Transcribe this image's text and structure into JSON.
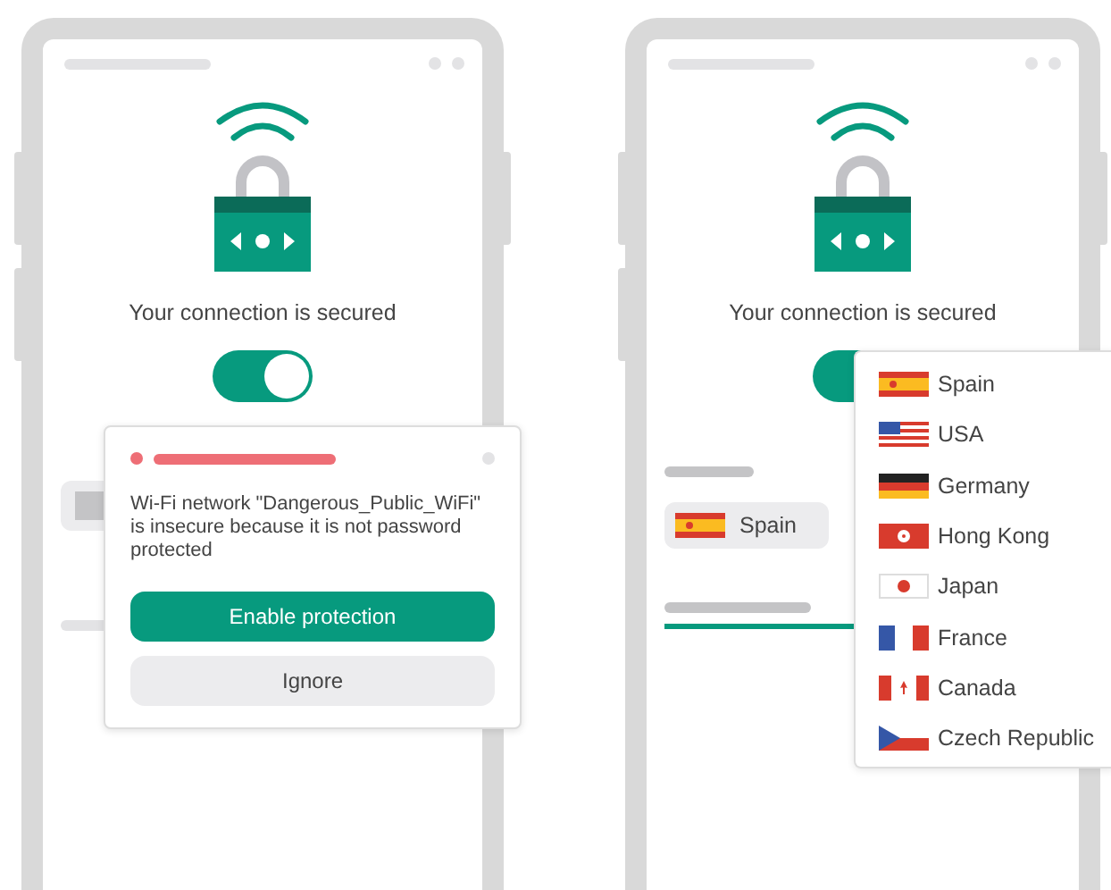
{
  "left_screen": {
    "connection_status": "Your connection is secured",
    "protection_toggle": {
      "on": true
    },
    "alert": {
      "message": "Wi-Fi network \"Dangerous_Public_WiFi\" is insecure because it is not password protected",
      "buttons": [
        {
          "label": "Enable protection",
          "kind": "primary"
        },
        {
          "label": "Ignore",
          "kind": "secondary"
        }
      ]
    }
  },
  "right_screen": {
    "connection_status": "Your connection is secured",
    "protection_toggle": {
      "on": true
    },
    "location_selector": {
      "label": "Spain",
      "kind": "spain"
    },
    "country_list": [
      {
        "name": "Spain",
        "kind": "spain"
      },
      {
        "name": "USA",
        "kind": "usa"
      },
      {
        "name": "Germany",
        "kind": "germany"
      },
      {
        "name": "Hong Kong",
        "kind": "hongkong"
      },
      {
        "name": "Japan",
        "kind": "japan"
      },
      {
        "name": "France",
        "kind": "france"
      },
      {
        "name": "Canada",
        "kind": "canada"
      },
      {
        "name": "Czech Republic",
        "kind": "czech"
      }
    ]
  }
}
